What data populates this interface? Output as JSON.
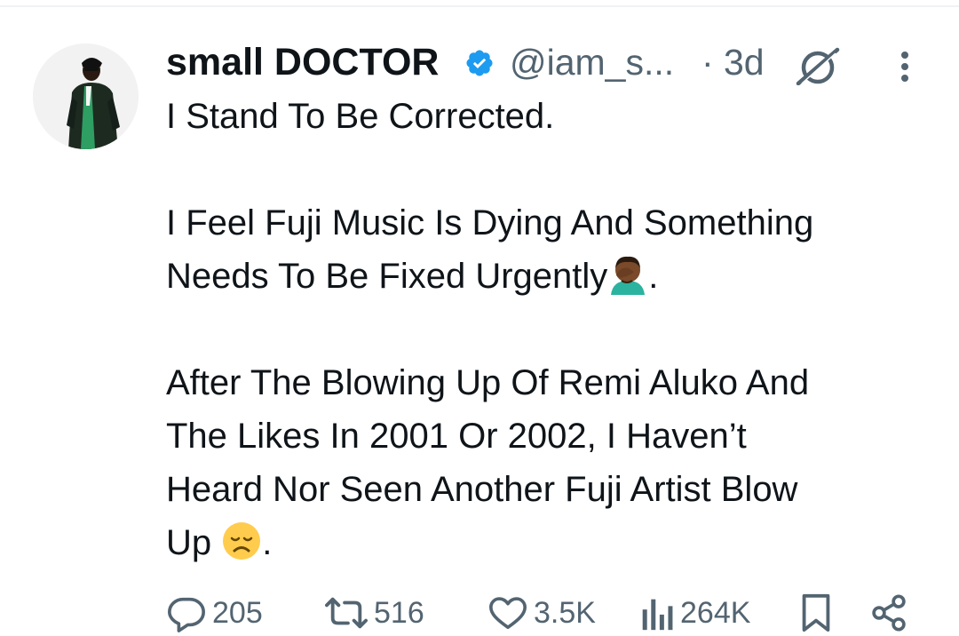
{
  "tweet": {
    "author": {
      "display_name": "small DOCTOR",
      "handle": "@iam_s...",
      "verified": true
    },
    "separator": "·",
    "time": "3d",
    "icons": {
      "verified": "verified-badge-icon",
      "grok": "grok-icon",
      "more": "more-options-icon"
    },
    "text": {
      "line1": "I Stand To Be Corrected.",
      "para2": "I Feel Fuji Music Is Dying And Something\nNeeds To Be Fixed Urgently",
      "para2_end": ".",
      "para3": "After The Blowing Up Of Remi Aluko And\nThe Likes In 2001 Or 2002, I Haven’t\nHeard Nor Seen Another Fuji Artist Blow\nUp ",
      "para3_end": "."
    },
    "emojis": {
      "facepalm": "man-facepalming-medium-dark-skin-emoji",
      "disappointed": "disappointed-face-emoji"
    },
    "actions": {
      "replies": "205",
      "reposts": "516",
      "likes": "3.5K",
      "views": "264K"
    },
    "colors": {
      "text": "#0f1419",
      "secondary": "#536471",
      "verified": "#1d9bf0"
    }
  }
}
